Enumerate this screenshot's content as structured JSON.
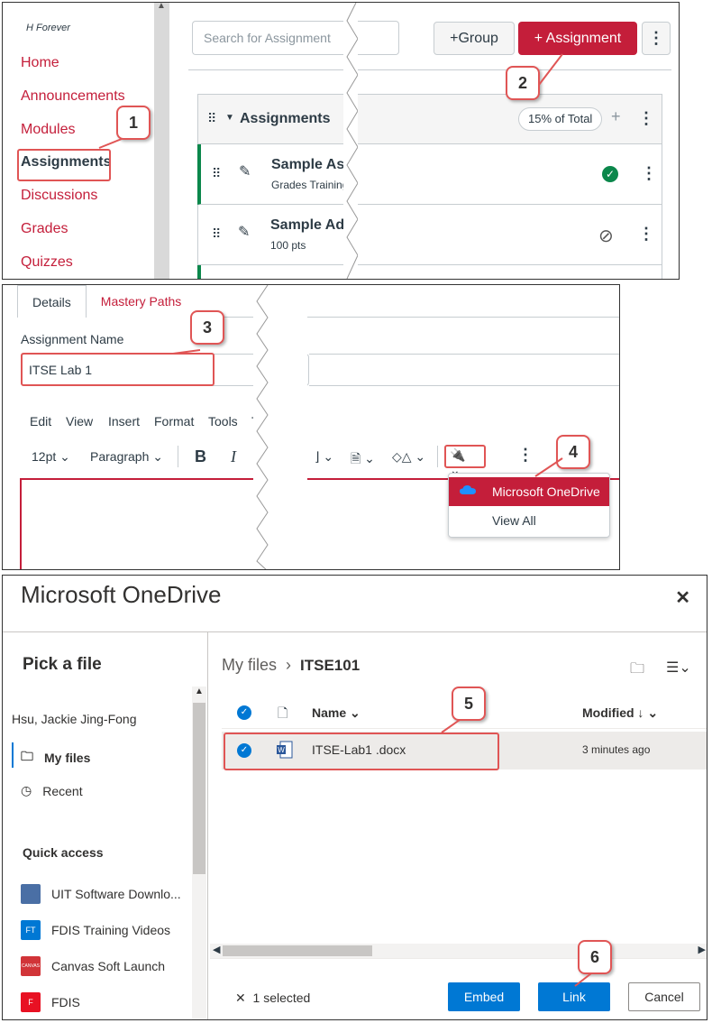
{
  "canvas_nav": {
    "org": "H Forever",
    "links": [
      "Home",
      "Announcements",
      "Modules",
      "Assignments",
      "Discussions",
      "Grades",
      "Quizzes"
    ],
    "active": "Assignments"
  },
  "assignments_page": {
    "search_placeholder": "Search for Assignment",
    "group_btn": "+Group",
    "assignment_btn": "+ Assignment",
    "group_title": "Assignments",
    "group_pct": "15% of Total",
    "rows": [
      {
        "title": "Sample Assig",
        "sub": "Grades Training M",
        "status": "published"
      },
      {
        "title": "Sample Addi",
        "sub": "100 pts",
        "status": "unpublished"
      }
    ]
  },
  "editor": {
    "tabs": [
      "Details",
      "Mastery Paths"
    ],
    "name_label": "Assignment Name",
    "name_value": "ITSE Lab 1",
    "menus": [
      "Edit",
      "View",
      "Insert",
      "Format",
      "Tools",
      "T"
    ],
    "font_size": "12pt",
    "block": "Paragraph",
    "bold": "B",
    "italic": "I",
    "dropdown_items": [
      "Microsoft OneDrive",
      "View All"
    ]
  },
  "onedrive": {
    "title": "Microsoft OneDrive",
    "pick": "Pick a file",
    "user": "Hsu, Jackie Jing-Fong",
    "nav": [
      "My files",
      "Recent"
    ],
    "quick_access_label": "Quick access",
    "quick_access": [
      {
        "label": "UIT Software Downlo...",
        "icon": "FT",
        "color": "#4a6fa5"
      },
      {
        "label": "FDIS Training Videos",
        "icon": "FT",
        "color": "#0078d4"
      },
      {
        "label": "Canvas Soft Launch",
        "icon": "CANVAS",
        "color": "#d13438"
      },
      {
        "label": "FDIS",
        "icon": "F",
        "color": "#e81123"
      }
    ],
    "breadcrumb": [
      "My files",
      "ITSE101"
    ],
    "col_name": "Name",
    "col_modified": "Modified ↓",
    "file": {
      "name": "ITSE-Lab1 .docx",
      "modified": "3 minutes ago"
    },
    "selected": "1 selected",
    "btn_embed": "Embed",
    "btn_link": "Link",
    "btn_cancel": "Cancel"
  },
  "callouts": [
    "1",
    "2",
    "3",
    "4",
    "5",
    "6"
  ],
  "colors": {
    "canvas_red": "#c41e3a",
    "od_blue": "#0078d4",
    "callout_red": "#e05555"
  }
}
